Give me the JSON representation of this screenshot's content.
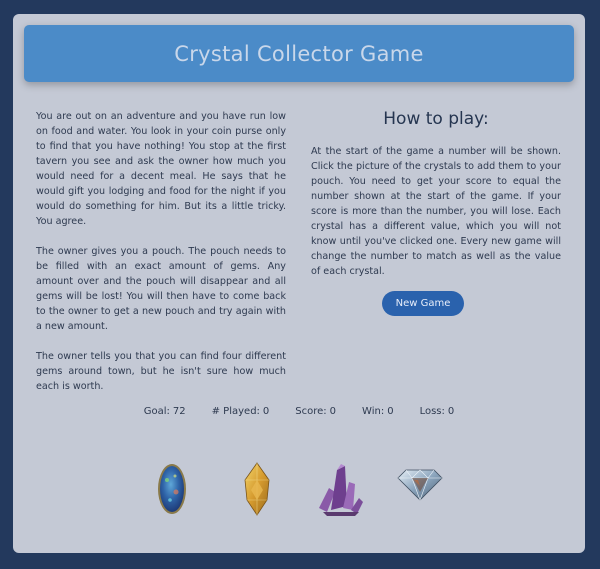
{
  "header": {
    "title": "Crystal Collector Game"
  },
  "story": {
    "paragraphs": [
      "You are out on an adventure and you have run low on food and water. You look in your coin purse only to find that you have nothing! You stop at the first tavern you see and ask the owner how much you would need for a decent meal. He says that he would gift you lodging and food for the night if you would do something for him. But its a little tricky. You agree.",
      "The owner gives you a pouch. The pouch needs to be filled with an exact amount of gems. Any amount over and the pouch will disappear and all gems will be lost! You will then have to come back to the owner to get a new pouch and try again with a new amount.",
      "The owner tells you that you can find four different gems around town, but he isn't sure how much each is worth."
    ]
  },
  "howto": {
    "title": "How to play:",
    "text": "At the start of the game a number will be shown. Click the picture of the crystals to add them to your pouch. You need to get your score to equal the number shown at the start of the game. If your score is more than the number, you will lose. Each crystal has a different value, which you will not know until you've clicked one. Every new game will change the number to match as well as the value of each crystal."
  },
  "button": {
    "label": "New Game"
  },
  "stats": {
    "goal_label": "Goal:",
    "goal": "72",
    "played_label": "# Played:",
    "played": "0",
    "score_label": "Score:",
    "score": "0",
    "win_label": "Win:",
    "win": "0",
    "loss_label": "Loss:",
    "loss": "0"
  },
  "crystals": [
    {
      "name": "blue-opal-crystal",
      "color": "#2f64a8"
    },
    {
      "name": "yellow-citrine-crystal",
      "color": "#d8b24a"
    },
    {
      "name": "purple-amethyst-crystal",
      "color": "#7a4b92"
    },
    {
      "name": "diamond-crystal",
      "color": "#9fb3c6"
    }
  ]
}
